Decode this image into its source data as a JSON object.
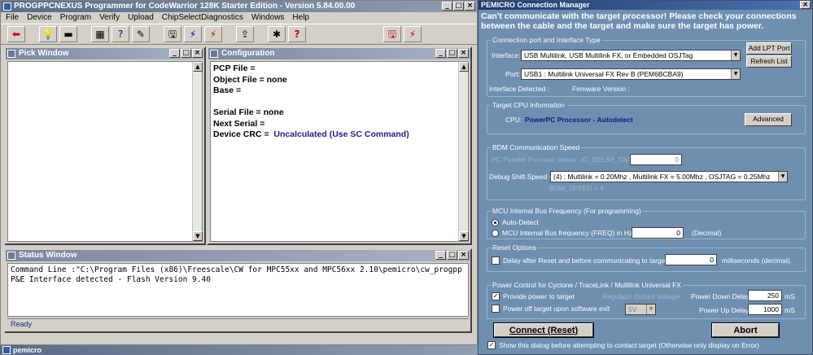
{
  "main": {
    "title": "PROGPPCNEXUS Programmer for CodeWarrior 128K Starter Edition - Version 5.84.00.00",
    "menu": [
      "File",
      "Device",
      "Program",
      "Verify",
      "Upload",
      "ChipSelectDiagnostics",
      "Windows",
      "Help"
    ],
    "pick": {
      "title": "Pick Window"
    },
    "config": {
      "title": "Configuration",
      "lines": [
        {
          "label": "PCP File =",
          "value": ""
        },
        {
          "label": "Object File = none",
          "value": ""
        },
        {
          "label": "Base =",
          "value": ""
        },
        {
          "label": "",
          "value": ""
        },
        {
          "label": "Serial File = none",
          "value": ""
        },
        {
          "label": "Next Serial  =",
          "value": ""
        },
        {
          "label": "Device CRC =",
          "value": "Uncalculated (Use SC Command)"
        }
      ]
    },
    "status": {
      "title": "Status Window",
      "line1": "Command Line :\"C:\\Program Files (x86)\\Freescale\\CW for MPC55xx and MPC56xx 2.10\\pemicro\\cw_progpp",
      "line2": "P&E Interface detected - Flash Version 9.40",
      "bar": "Ready"
    },
    "taskbar": "pemicro"
  },
  "dialog": {
    "title": "PEMICRO Connection Manager",
    "message": "Can't communicate with the target processor! Please check your connections between the cable and the target and make sure the target has power.",
    "conn_group": "Connection port and Interface Type",
    "interface_label": "Interface:",
    "interface_value": "USB Multilink, USB Multilink FX, or Embedded OSJTag",
    "port_label": "Port:",
    "port_value": "USB1 : Multilink Universal FX Rev B (PEM6BCBA9)",
    "interface_detected": "Interface Detected :",
    "firmware_version": "Firmware Version :",
    "add_lpt": "Add LPT Port",
    "refresh": "Refresh List",
    "cpu_group": "Target CPU Information",
    "cpu_label": "CPU:",
    "cpu_value": "PowerPC Processor - Autodetect",
    "advanced": "Advanced",
    "bdm_group": "BDM Communication Speed",
    "pc_parallel": "PC Parallel Port wait states : IO_DELAY_CNT =",
    "pc_parallel_value": "0",
    "debug_shift": "Debug Shift Speed =",
    "debug_shift_value": "(4) :  Multilink = 0.20Mhz  ,  Multilink FX = 5.00Mhz  ,  OSJTAG = 0.25Mhz",
    "bdm_speed": "BDM_SPEED = 4",
    "mcu_group": "MCU Internal Bus Frequency (For programming)",
    "auto_detect": "Auto-Detect",
    "mcu_freq": "MCU Internal Bus frequency (FREQ) in Hz =",
    "mcu_freq_value": "0",
    "decimal": "(Decimal)",
    "reset_group": "Reset Options",
    "delay_label": "Delay after Reset and before communicating to target for",
    "delay_value": "0",
    "delay_units": "milliseconds (decimal).",
    "power_group": "Power Control for Cyclone / TraceLink / Multilink Universal FX",
    "provide_power": "Provide power to target",
    "regulator": "Regulator Output Voltage",
    "power_down": "Power Down Delay",
    "power_down_value": "250",
    "power_off": "Power off target upon software exit",
    "voltage": "5V",
    "power_up": "Power Up Delay",
    "power_up_value": "1000",
    "ms": "mS",
    "connect": "Connect (Reset)",
    "abort": "Abort",
    "show_dialog": "Show this dialog before attempting to contact target (Otherwise only display on Error)"
  }
}
